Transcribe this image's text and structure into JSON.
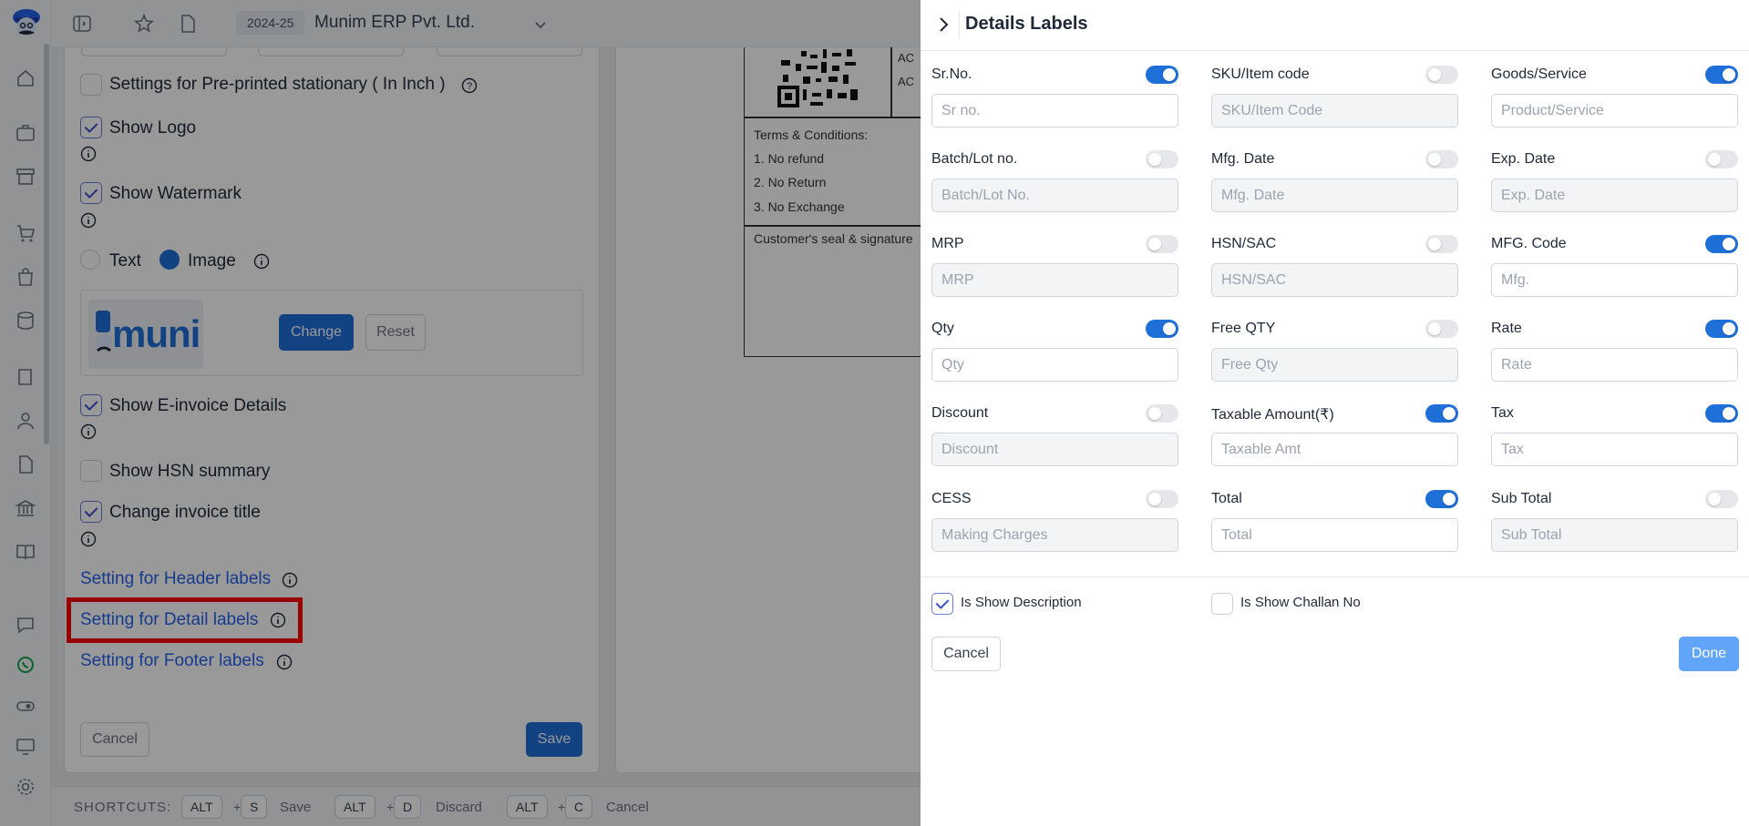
{
  "topbar": {
    "fy_badge": "2024-25",
    "company": "Munim ERP Pvt. Ltd."
  },
  "left_panel": {
    "pre_printed": "Settings for Pre-printed stationary ( In Inch )",
    "show_logo": "Show Logo",
    "show_watermark": "Show Watermark",
    "watermark_text": "Text",
    "watermark_image": "Image",
    "logo_preview": "muni",
    "change": "Change",
    "reset": "Reset",
    "show_einvoice": "Show E-invoice Details",
    "show_hsn": "Show HSN summary",
    "change_title": "Change invoice title",
    "header_labels": "Setting for Header labels",
    "detail_labels": "Setting for Detail labels",
    "footer_labels": "Setting for Footer labels",
    "cancel": "Cancel",
    "save": "Save"
  },
  "preview": {
    "ac1": "AC",
    "ac2": "AC",
    "terms": "Terms & Conditions:",
    "t1": "1. No refund",
    "t2": "2. No Return",
    "t3": "3. No Exchange",
    "seal": "Customer's seal & signature"
  },
  "shortcuts": {
    "title": "SHORTCUTS:",
    "alt": "ALT",
    "plus": "+",
    "s": "S",
    "save": "Save",
    "d": "D",
    "discard": "Discard",
    "c": "C",
    "cancel": "Cancel"
  },
  "drawer": {
    "title": "Details Labels",
    "fields": [
      {
        "label": "Sr.No.",
        "placeholder": "Sr no.",
        "on": true,
        "disabled": false
      },
      {
        "label": "SKU/Item code",
        "placeholder": "SKU/Item Code",
        "on": false,
        "disabled": true
      },
      {
        "label": "Goods/Service",
        "placeholder": "Product/Service",
        "on": true,
        "disabled": false
      },
      {
        "label": "Batch/Lot no.",
        "placeholder": "Batch/Lot No.",
        "on": false,
        "disabled": true
      },
      {
        "label": "Mfg. Date",
        "placeholder": "Mfg. Date",
        "on": false,
        "disabled": true
      },
      {
        "label": "Exp. Date",
        "placeholder": "Exp. Date",
        "on": false,
        "disabled": true
      },
      {
        "label": "MRP",
        "placeholder": "MRP",
        "on": false,
        "disabled": true
      },
      {
        "label": "HSN/SAC",
        "placeholder": "HSN/SAC",
        "on": false,
        "disabled": true
      },
      {
        "label": "MFG. Code",
        "placeholder": "Mfg.",
        "on": true,
        "disabled": false
      },
      {
        "label": "Qty",
        "placeholder": "Qty",
        "on": true,
        "disabled": false
      },
      {
        "label": "Free QTY",
        "placeholder": "Free Qty",
        "on": false,
        "disabled": true
      },
      {
        "label": "Rate",
        "placeholder": "Rate",
        "on": true,
        "disabled": false
      },
      {
        "label": "Discount",
        "placeholder": "Discount",
        "on": false,
        "disabled": true
      },
      {
        "label": "Taxable Amount(₹)",
        "placeholder": "Taxable Amt",
        "on": true,
        "disabled": false
      },
      {
        "label": "Tax",
        "placeholder": "Tax",
        "on": true,
        "disabled": false
      },
      {
        "label": "CESS",
        "placeholder": "Making Charges",
        "on": false,
        "disabled": true
      },
      {
        "label": "Total",
        "placeholder": "Total",
        "on": true,
        "disabled": false
      },
      {
        "label": "Sub Total",
        "placeholder": "Sub Total",
        "on": false,
        "disabled": true
      }
    ],
    "show_description": "Is Show Description",
    "show_challan": "Is Show Challan No",
    "cancel": "Cancel",
    "done": "Done"
  }
}
